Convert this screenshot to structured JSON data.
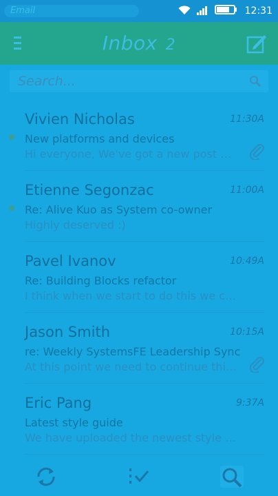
{
  "status": {
    "app_name": "Email",
    "time": "12:31",
    "icons": [
      "wifi-icon",
      "signal-icon",
      "battery-icon"
    ]
  },
  "header": {
    "title": "Inbox",
    "unread_count": "2",
    "color": "#24a58e"
  },
  "search": {
    "placeholder": "Search..."
  },
  "messages": [
    {
      "sender": "Vivien Nicholas",
      "time": "11:30A",
      "subject": "New platforms and devices",
      "preview": "Hi everyone, We've got a new post up...",
      "unread": true,
      "attachment": true
    },
    {
      "sender": "Etienne Segonzac",
      "time": "11:00A",
      "subject": "Re: Alive Kuo as System co-owner",
      "preview": "Highly deserved :)",
      "unread": true,
      "attachment": false
    },
    {
      "sender": "Pavel Ivanov",
      "time": "10:49A",
      "subject": "Re: Building Blocks refactor",
      "preview": "I think when we start to do this we can ex...",
      "unread": false,
      "attachment": false
    },
    {
      "sender": "Jason Smith",
      "time": "10:15A",
      "subject": "re: Weekly SystemsFE Leadership Sync",
      "preview": "At this point we need to continue this...",
      "unread": false,
      "attachment": true
    },
    {
      "sender": "Eric Pang",
      "time": "9:37A",
      "subject": "Latest style guide",
      "preview": "We have uploaded the newest style guide...",
      "unread": false,
      "attachment": false
    }
  ],
  "toolbar": {
    "items": [
      "refresh-icon",
      "edit-select-icon",
      "search-icon"
    ]
  },
  "colors": {
    "background": "#17a8e1",
    "status_bar": "#1592d1",
    "unread_dot": "#3d9e93"
  }
}
